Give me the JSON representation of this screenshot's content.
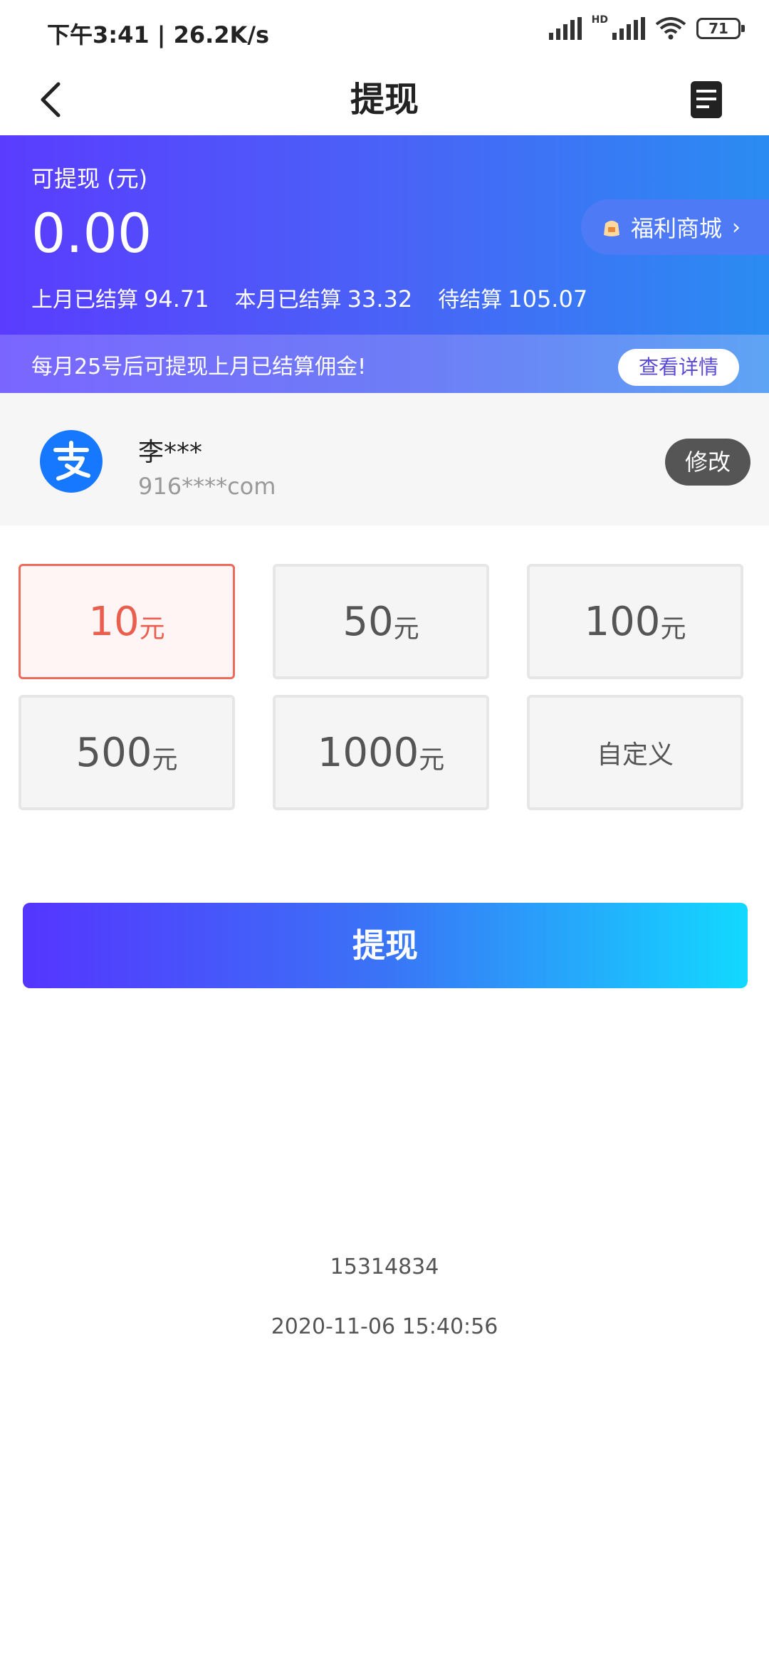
{
  "status_bar": {
    "time": "下午3:41 | 26.2K/s",
    "hd_label": "HD",
    "battery": "71"
  },
  "header": {
    "title": "提现",
    "back_icon": "back-chevron-icon",
    "records_icon": "document-list-icon"
  },
  "balance": {
    "label": "可提现 (元)",
    "amount": "0.00",
    "stats": [
      {
        "label": "上月已结算",
        "value": "94.71"
      },
      {
        "label": "本月已结算",
        "value": "33.32"
      },
      {
        "label": "待结算",
        "value": "105.07"
      }
    ],
    "mall_button": {
      "label": "福利商城",
      "chevron": "›",
      "icon": "shopping-bag-icon"
    }
  },
  "notice": {
    "text": "每月25号后可提现上月已结算佣金!",
    "details_label": "查看详情"
  },
  "account": {
    "icon": "alipay-icon",
    "name": "李***",
    "id": "916****com",
    "edit_label": "修改"
  },
  "amount_options": [
    {
      "value": "10",
      "unit": "元",
      "selected": true
    },
    {
      "value": "50",
      "unit": "元",
      "selected": false
    },
    {
      "value": "100",
      "unit": "元",
      "selected": false
    },
    {
      "value": "500",
      "unit": "元",
      "selected": false
    },
    {
      "value": "1000",
      "unit": "元",
      "selected": false
    },
    {
      "label": "自定义",
      "selected": false
    }
  ],
  "submit_label": "提现",
  "footer": {
    "id": "15314834",
    "timestamp": "2020-11-06 15:40:56"
  },
  "colors": {
    "accent_start": "#5535ff",
    "accent_end": "#12d9ff",
    "selected": "#ea5e4e",
    "alipay": "#1677ff"
  }
}
